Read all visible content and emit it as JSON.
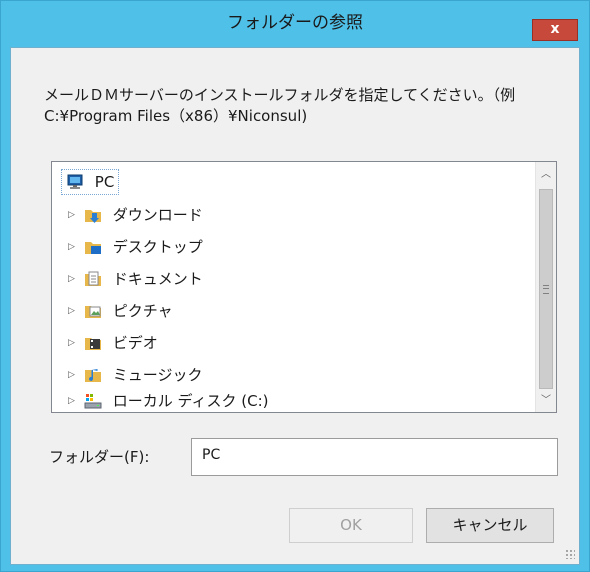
{
  "window": {
    "title": "フォルダーの参照",
    "close_label": "x"
  },
  "instruction": {
    "line1": "メールＤＭサーバーのインストールフォルダを指定してください。（例",
    "line2": "C:¥Program Files（x86）¥Niconsul)"
  },
  "tree": {
    "root": {
      "label": "PC",
      "icon": "computer-icon"
    },
    "items": [
      {
        "label": "ダウンロード",
        "icon": "downloads-folder-icon"
      },
      {
        "label": "デスクトップ",
        "icon": "desktop-folder-icon"
      },
      {
        "label": "ドキュメント",
        "icon": "documents-folder-icon"
      },
      {
        "label": "ピクチャ",
        "icon": "pictures-folder-icon"
      },
      {
        "label": "ビデオ",
        "icon": "videos-folder-icon"
      },
      {
        "label": "ミュージック",
        "icon": "music-folder-icon"
      },
      {
        "label": "ローカル ディスク (C:)",
        "icon": "local-disk-icon"
      }
    ]
  },
  "folder_field": {
    "label": "フォルダー(F):",
    "value": "PC"
  },
  "buttons": {
    "ok": "OK",
    "cancel": "キャンセル"
  },
  "colors": {
    "titlebar": "#4fc1e9",
    "close": "#c6493b",
    "client": "#f0f0f0"
  }
}
